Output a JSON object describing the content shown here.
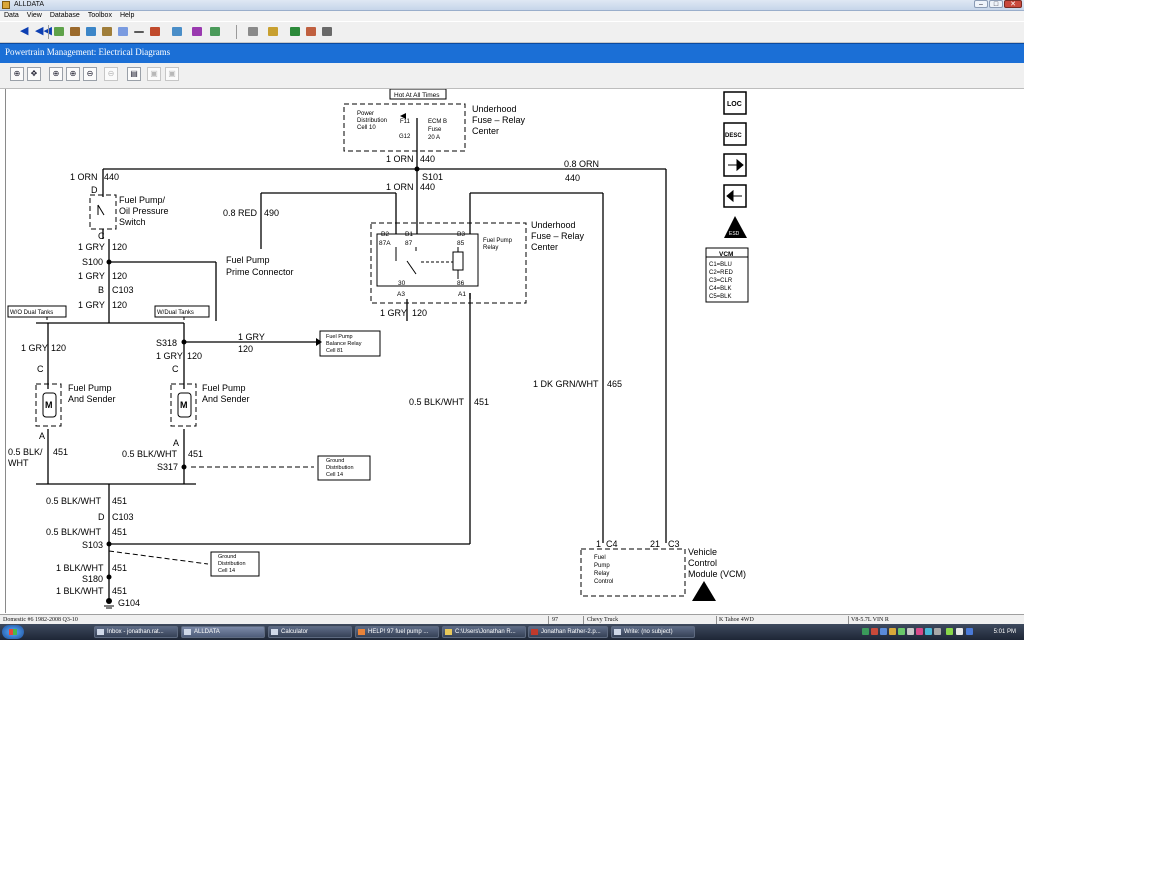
{
  "window": {
    "title": "ALLDATA",
    "minimize": "–",
    "maximize": "□",
    "close": "✕"
  },
  "menu": [
    "Data",
    "View",
    "Database",
    "Toolbox",
    "Help"
  ],
  "section": {
    "title": "Powertrain Management:  Electrical Diagrams"
  },
  "viewer_tools": [
    "zoom-in-icon",
    "pan-icon",
    "zoom-window-icon",
    "zoom-region-icon",
    "zoom-out-icon",
    "zoom-disabled-icon",
    "print-icon",
    "copy-icon",
    "paste-icon"
  ],
  "side_nav": {
    "loc": "LOC",
    "desc": "DESC",
    "esd": "ESD"
  },
  "vcm_legend": {
    "title": "VCM",
    "rows": [
      "C1=BLU",
      "C2=RED",
      "C3=CLR",
      "C4=BLK",
      "C5=BLK"
    ]
  },
  "diagram": {
    "labels": {
      "hot": "Hot At All Times",
      "pd1": "Power",
      "pd2": "Distribution",
      "pd3": "Cell 10",
      "f11": "F11",
      "g12": "G12",
      "ecm1": "ECM B",
      "ecm2": "Fuse",
      "ecm3": "20 A",
      "uf1a": "Underhood",
      "uf1b": "Fuse – Relay",
      "uf1c": "Center",
      "w1orn440a": "1 ORN",
      "n440a": "440",
      "w08orn": "0.8 ORN",
      "n440b": "440",
      "w1orn440c": "1 ORN",
      "n440c": "440",
      "s101": "S101",
      "w1orn440d": "1 ORN",
      "n440d": "440",
      "sw_d": "D",
      "sw1": "Fuel Pump/",
      "sw2": "Oil Pressure",
      "sw3": "Switch",
      "sw_c": "C",
      "w08red": "0.8 RED",
      "n490": "490",
      "w1gry120a": "1 GRY",
      "n120a": "120",
      "s100": "S100",
      "w1gry120b": "1 GRY",
      "n120b": "120",
      "b_c103": "B",
      "c103a": "C103",
      "w1gry120c": "1 GRY",
      "n120c": "120",
      "fppc1": "Fuel Pump",
      "fppc2": "Prime Connector",
      "uf2a": "Underhood",
      "uf2b": "Fuse – Relay",
      "uf2c": "Center",
      "b2": "B2",
      "b1": "B1",
      "b3": "B3",
      "p87a": "87A",
      "p87": "87",
      "p85": "85",
      "fpr1": "Fuel Pump",
      "fpr2": "Relay",
      "p30": "30",
      "p86": "86",
      "a3": "A3",
      "a1": "A1",
      "w1gry120d": "1 GRY",
      "n120d": "120",
      "wo_dual": "W/O Dual Tanks",
      "w_dual": "W/Dual Tanks",
      "w1gry120e": "1 GRY",
      "n120e": "120",
      "s318": "S318",
      "w1gry120f": "1 GRY",
      "n120f": "120",
      "w1gry_r": "1 GRY",
      "n120_r": "120",
      "bal1": "Fuel Pump",
      "bal2": "Balance Relay",
      "bal3": "Cell 81",
      "c_l": "C",
      "c_r": "C",
      "fps1a": "Fuel Pump",
      "fps1b": "And Sender",
      "fps2a": "Fuel Pump",
      "fps2b": "And Sender",
      "m1": "M",
      "m2": "M",
      "a_l": "A",
      "a_r": "A",
      "w05bw_l1": "0.5 BLK/",
      "w05bw_l2": "WHT",
      "n451_l": "451",
      "w05bw_r": "0.5 BLK/WHT",
      "n451_r": "451",
      "s317": "S317",
      "gd1a": "Ground",
      "gd1b": "Distribution",
      "gd1c": "Cell 14",
      "w05bw_mid": "0.5 BLK/WHT",
      "n451_mid": "451",
      "w1dkgrn": "1 DK GRN/WHT",
      "n465": "465",
      "w05bw_a": "0.5 BLK/WHT",
      "n451_a": "451",
      "d_c103": "D",
      "c103b": "C103",
      "w05bw_b": "0.5 BLK/WHT",
      "n451_b": "451",
      "s103": "S103",
      "gd2a": "Ground",
      "gd2b": "Distribution",
      "gd2c": "Cell 14",
      "w1bw_a": "1 BLK/WHT",
      "n451_c": "451",
      "s180": "S180",
      "w1bw_b": "1 BLK/WHT",
      "n451_d": "451",
      "g104": "G104",
      "c4num": "1",
      "c4": "C4",
      "c3num": "21",
      "c3": "C3",
      "vcm1": "Vehicle",
      "vcm2": "Control",
      "vcm3": "Module (VCM)",
      "fprc1": "Fuel",
      "fprc2": "Pump",
      "fprc3": "Relay",
      "fprc4": "Control"
    }
  },
  "status": {
    "s1": "Domestic #6 1982-2008 Q3-10",
    "s2": "97",
    "s3": "Chevy Truck",
    "s4": "K Tahoe 4WD",
    "s5": "V8-5.7L VIN R"
  },
  "taskbar": {
    "items": [
      "Inbox - jonathan.rat...",
      "ALLDATA",
      "Calculator",
      "HELP! 97 fuel pump ...",
      "C:\\Users\\Jonathan R...",
      "Jonathan Rather-2.p...",
      "Write: (no subject)"
    ],
    "clock": "5:01 PM"
  },
  "colors": {
    "section_bar": "#1b6fd6",
    "taskbar": "#2a3446",
    "diagram_ink": "#000000"
  }
}
